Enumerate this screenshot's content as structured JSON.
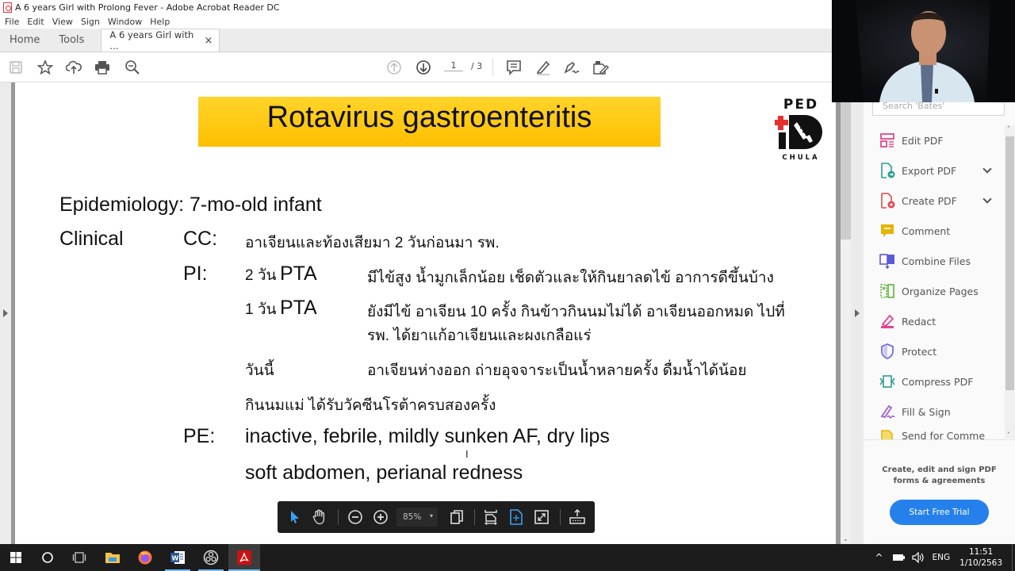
{
  "window": {
    "title": "A 6 years Girl with Prolong Fever - Adobe Acrobat Reader DC"
  },
  "menu": [
    "File",
    "Edit",
    "View",
    "Sign",
    "Window",
    "Help"
  ],
  "tabs": {
    "home": "Home",
    "tools": "Tools",
    "document": "A 6 years Girl with ...",
    "close": "×"
  },
  "toolbar": {
    "page_current": "1",
    "page_total": "/ 3"
  },
  "slide": {
    "title": "Rotavirus gastroenteritis",
    "logo": {
      "top": "PED",
      "bottom": "CHULA"
    },
    "epidemiology": "Epidemiology: 7-mo-old infant",
    "clinical_label": "Clinical",
    "cc_label": "CC:",
    "cc_text": "อาเจียนและท้องเสียมา 2 วันก่อนมา รพ.",
    "pi_label": "PI:",
    "pi": [
      {
        "day_num": "2 วัน",
        "day_tag": "PTA",
        "text": "มีไข้สูง น้ำมูกเล็กน้อย เช็ดตัวและให้กินยาลดไข้ อาการดีขึ้นบ้าง"
      },
      {
        "day_num": "1 วัน",
        "day_tag": "PTA",
        "text": "ยังมีไข้ อาเจียน 10 ครั้ง กินข้าวกินนมไม่ได้ อาเจียนออกหมด ไปที่",
        "text2": "รพ. ได้ยาแก้อาเจียนและผงเกลือแร่"
      },
      {
        "day_num": "วันนี้",
        "day_tag": "",
        "text": "อาเจียนห่างออก ถ่ายอุจจาระเป็นน้ำหลายครั้ง ดื่มน้ำได้น้อย"
      }
    ],
    "extra": "กินนมแม่ ได้รับวัคซีนโรต้าครบสองครั้ง",
    "pe_label": "PE:",
    "pe_line1": "inactive, febrile, mildly sunken AF, dry lips",
    "pe_line2": "soft abdomen, perianal redness"
  },
  "floating_toolbar": {
    "zoom": "85%"
  },
  "right_panel": {
    "search_placeholder": "Search 'Bates'",
    "tools": [
      {
        "label": "Edit PDF",
        "color": "#e0468f"
      },
      {
        "label": "Export PDF",
        "color": "#2a9d8f",
        "dropdown": true
      },
      {
        "label": "Create PDF",
        "color": "#e5484d",
        "dropdown": true
      },
      {
        "label": "Comment",
        "color": "#e3b505"
      },
      {
        "label": "Combine Files",
        "color": "#5b5bd6"
      },
      {
        "label": "Organize Pages",
        "color": "#5fb336"
      },
      {
        "label": "Redact",
        "color": "#e0468f"
      },
      {
        "label": "Protect",
        "color": "#6e6ee0"
      },
      {
        "label": "Compress PDF",
        "color": "#2a9d8f"
      },
      {
        "label": "Fill & Sign",
        "color": "#9b59d0"
      },
      {
        "label": "Send for Comme",
        "color": "#e3b505"
      }
    ],
    "promo_text_1": "Create, edit and sign PDF",
    "promo_text_2": "forms & agreements",
    "promo_button": "Start Free Trial"
  },
  "taskbar": {
    "time": "11:51",
    "date": "1/10/2563",
    "lang": "ENG"
  }
}
